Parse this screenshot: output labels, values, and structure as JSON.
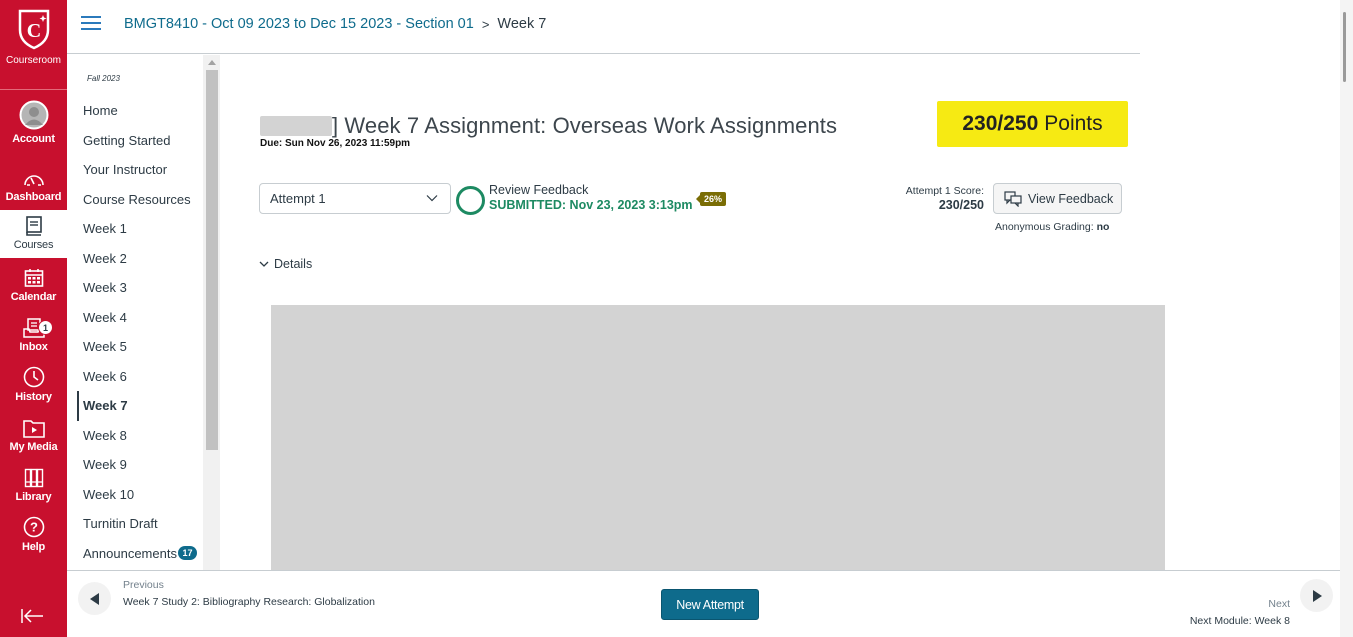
{
  "global_nav": {
    "brand": "Courseroom",
    "items": [
      {
        "label": "Account",
        "icon": "account-avatar-icon"
      },
      {
        "label": "Dashboard",
        "icon": "dashboard-gauge-icon"
      },
      {
        "label": "Courses",
        "icon": "courses-book-icon",
        "active": true
      },
      {
        "label": "Calendar",
        "icon": "calendar-icon"
      },
      {
        "label": "Inbox",
        "icon": "inbox-icon",
        "badge": "1"
      },
      {
        "label": "History",
        "icon": "clock-icon"
      },
      {
        "label": "My Media",
        "icon": "media-folder-icon"
      },
      {
        "label": "Library",
        "icon": "library-books-icon"
      },
      {
        "label": "Help",
        "icon": "help-question-icon"
      }
    ],
    "collapse_icon": "collapse-arrow-icon"
  },
  "header": {
    "breadcrumb": [
      {
        "label": "BMGT8410 - Oct 09 2023 to Dec 15 2023 - Section 01"
      },
      {
        "label": "Week 7"
      }
    ]
  },
  "course_nav": {
    "term": "Fall 2023",
    "items": [
      {
        "label": "Home"
      },
      {
        "label": "Getting Started"
      },
      {
        "label": "Your Instructor"
      },
      {
        "label": "Course Resources"
      },
      {
        "label": "Week 1"
      },
      {
        "label": "Week 2"
      },
      {
        "label": "Week 3"
      },
      {
        "label": "Week 4"
      },
      {
        "label": "Week 5"
      },
      {
        "label": "Week 6"
      },
      {
        "label": "Week 7",
        "active": true
      },
      {
        "label": "Week 8"
      },
      {
        "label": "Week 9"
      },
      {
        "label": "Week 10"
      },
      {
        "label": "Turnitin Draft"
      },
      {
        "label": "Announcements",
        "badge": "17"
      }
    ]
  },
  "assignment": {
    "title": "] Week 7 Assignment: Overseas Work Assignments",
    "due": "Due: Sun Nov 26, 2023 11:59pm",
    "points_score": "230/250",
    "points_label": "Points",
    "attempt_select": "Attempt 1",
    "review_feedback": "Review Feedback",
    "submitted": "SUBMITTED: Nov 23, 2023 3:13pm",
    "similarity": "26%",
    "attempt_score_label": "Attempt 1 Score:",
    "attempt_score_value": "230/250",
    "view_feedback": "View Feedback",
    "anonymous_grading_label": "Anonymous Grading:",
    "anonymous_grading_value": "no",
    "details": "Details"
  },
  "footer": {
    "previous_label": "Previous",
    "previous_title": "Week 7 Study 2: Bibliography Research: Globalization",
    "new_attempt": "New Attempt",
    "next_label": "Next",
    "next_title": "Next Module: Week 8"
  },
  "colors": {
    "brand_red": "#c8102e",
    "link_blue": "#0e6b8c",
    "success_green": "#1d8a62",
    "highlight_yellow": "#f6ea13"
  }
}
